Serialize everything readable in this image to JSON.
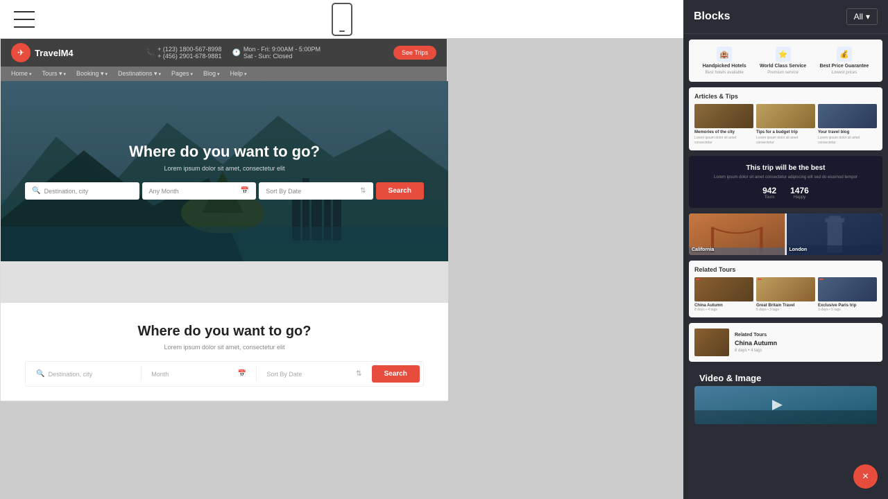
{
  "header": {
    "hamburger_label": "menu",
    "mobile_icon_label": "mobile preview"
  },
  "website": {
    "logo_text": "TravelM4",
    "contact_phone1": "+ (123) 1800-567-8998",
    "contact_phone2": "+ (456) 2901-678-9881",
    "hours_weekday": "Mon - Fri: 9:00AM - 5:00PM",
    "hours_weekend": "Sat - Sun: Closed",
    "see_trips_label": "See Trips",
    "nav_items": [
      "Home",
      "Tours",
      "Booking",
      "Destinations",
      "Pages",
      "Blog",
      "Help"
    ],
    "nav_no_arrow": [
      "Home",
      "Blog",
      "Help"
    ],
    "hero_title": "Where do you want to go?",
    "hero_subtitle": "Lorem ipsum dolor sit amet, consectetur elit",
    "search_destination_placeholder": "Destination, city",
    "search_month_placeholder": "Any Month",
    "search_sort_placeholder": "Sort By Date",
    "search_button_label": "Search"
  },
  "section2": {
    "title": "Where do you want to go?",
    "subtitle": "Lorem ipsum dolor sit amet, consectetur elit",
    "destination_placeholder": "Destination, city",
    "month_placeholder": "Month",
    "sort_placeholder": "Sort By Date",
    "search_label": "Search"
  },
  "right_panel": {
    "title": "Blocks",
    "all_label": "All",
    "dropdown_arrow": "▾",
    "block1": {
      "items": [
        {
          "icon": "🏨",
          "label": "Handpicked Hotels",
          "sub": "Best hotels available"
        },
        {
          "icon": "⭐",
          "label": "World Class Service",
          "sub": "Premium service"
        },
        {
          "icon": "💰",
          "label": "Best Price Guarantee",
          "sub": "Lowest prices"
        }
      ]
    },
    "block2": {
      "title": "Articles & Tips",
      "items": [
        {
          "title": "Memories of the city",
          "text": "Lorem ipsum dolor sit amet consectetur"
        },
        {
          "title": "Tips for a budget trip",
          "text": "Lorem ipsum dolor sit amet consectetur"
        },
        {
          "title": "Your travel blog",
          "text": "Lorem ipsum dolor sit amet consectetur"
        }
      ]
    },
    "block3": {
      "title": "This trip will be the best",
      "subtitle": "Lorem ipsum dolor sit amet consectetur adipiscing elit sed do eiusmod tempor",
      "stats": [
        {
          "number": "942",
          "label": "Tours"
        },
        {
          "number": "1476",
          "label": "Happy"
        }
      ]
    },
    "block4": {
      "items": [
        {
          "label": "California"
        },
        {
          "label": "London"
        }
      ]
    },
    "block5": {
      "title": "Related Tours",
      "items": [
        {
          "title": "China Autumn",
          "sub": "8 days",
          "tag": ""
        },
        {
          "title": "Great Britain Travel",
          "sub": "5 days",
          "tag": ""
        },
        {
          "title": "Exclusive Paris trip",
          "sub": "3 days",
          "tag": ""
        }
      ]
    },
    "block6": {
      "section_title": "Related Tours",
      "item_title": "China Autumn",
      "item_meta": "8 days • 4 tags"
    },
    "video_section_label": "Video & Image"
  },
  "close_button_label": "×"
}
